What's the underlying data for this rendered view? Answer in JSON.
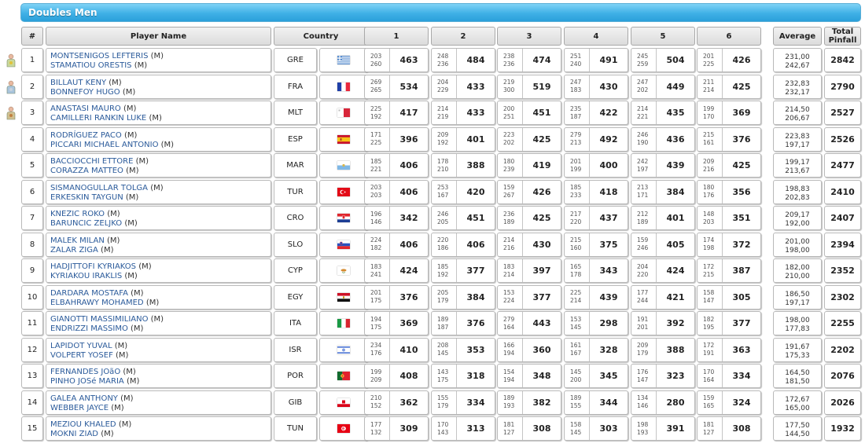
{
  "title": "Doubles Men",
  "headers": {
    "rank": "#",
    "player": "Player Name",
    "country": "Country",
    "games": [
      "1",
      "2",
      "3",
      "4",
      "5",
      "6"
    ],
    "average": "Average",
    "total": "Total Pinfall"
  },
  "colors": {
    "title_bar": "#3fb0e6",
    "player_link": "#2a5a9a"
  },
  "medals": [
    "gold-medal-icon",
    "silver-medal-icon",
    "bronze-medal-icon"
  ],
  "rows": [
    {
      "rank": "1",
      "p1": "MONTSENIGOS LEFTERIS",
      "p2": "STAMATIOU ORESTIS",
      "g1": "(M)",
      "g2": "(M)",
      "country": "GRE",
      "flag": "greece-flag-icon",
      "games": [
        [
          "203",
          "260",
          "463"
        ],
        [
          "248",
          "236",
          "484"
        ],
        [
          "238",
          "236",
          "474"
        ],
        [
          "251",
          "240",
          "491"
        ],
        [
          "245",
          "259",
          "504"
        ],
        [
          "201",
          "225",
          "426"
        ]
      ],
      "avg1": "231,00",
      "avg2": "242,67",
      "total": "2842"
    },
    {
      "rank": "2",
      "p1": "BILLAUT KENY",
      "p2": "BONNEFOY HUGO",
      "g1": "(M)",
      "g2": "(M)",
      "country": "FRA",
      "flag": "france-flag-icon",
      "games": [
        [
          "269",
          "265",
          "534"
        ],
        [
          "204",
          "229",
          "433"
        ],
        [
          "219",
          "300",
          "519"
        ],
        [
          "247",
          "183",
          "430"
        ],
        [
          "247",
          "202",
          "449"
        ],
        [
          "211",
          "214",
          "425"
        ]
      ],
      "avg1": "232,83",
      "avg2": "232,17",
      "total": "2790"
    },
    {
      "rank": "3",
      "p1": "ANASTASI MAURO",
      "p2": "CAMILLERI RANKIN LUKE",
      "g1": "(M)",
      "g2": "(M)",
      "country": "MLT",
      "flag": "malta-flag-icon",
      "games": [
        [
          "225",
          "192",
          "417"
        ],
        [
          "214",
          "219",
          "433"
        ],
        [
          "200",
          "251",
          "451"
        ],
        [
          "235",
          "187",
          "422"
        ],
        [
          "214",
          "221",
          "435"
        ],
        [
          "199",
          "170",
          "369"
        ]
      ],
      "avg1": "214,50",
      "avg2": "206,67",
      "total": "2527"
    },
    {
      "rank": "4",
      "p1": "RODRÍGUEZ PACO",
      "p2": "PICCARI MICHAEL ANTONIO",
      "g1": "(M)",
      "g2": "(M)",
      "country": "ESP",
      "flag": "spain-flag-icon",
      "games": [
        [
          "171",
          "225",
          "396"
        ],
        [
          "209",
          "192",
          "401"
        ],
        [
          "223",
          "202",
          "425"
        ],
        [
          "279",
          "213",
          "492"
        ],
        [
          "246",
          "190",
          "436"
        ],
        [
          "215",
          "161",
          "376"
        ]
      ],
      "avg1": "223,83",
      "avg2": "197,17",
      "total": "2526"
    },
    {
      "rank": "5",
      "p1": "BACCIOCCHI ETTORE",
      "p2": "CORAZZA MATTEO",
      "g1": "(M)",
      "g2": "(M)",
      "country": "MAR",
      "flag": "san-marino-flag-icon",
      "games": [
        [
          "185",
          "221",
          "406"
        ],
        [
          "178",
          "210",
          "388"
        ],
        [
          "180",
          "239",
          "419"
        ],
        [
          "201",
          "199",
          "400"
        ],
        [
          "242",
          "197",
          "439"
        ],
        [
          "209",
          "216",
          "425"
        ]
      ],
      "avg1": "199,17",
      "avg2": "213,67",
      "total": "2477"
    },
    {
      "rank": "6",
      "p1": "SISMANOGULLAR TOLGA",
      "p2": "ERKESKIN TAYGUN",
      "g1": "(M)",
      "g2": "(M)",
      "country": "TUR",
      "flag": "turkey-flag-icon",
      "games": [
        [
          "203",
          "203",
          "406"
        ],
        [
          "253",
          "167",
          "420"
        ],
        [
          "159",
          "267",
          "426"
        ],
        [
          "185",
          "233",
          "418"
        ],
        [
          "213",
          "171",
          "384"
        ],
        [
          "180",
          "176",
          "356"
        ]
      ],
      "avg1": "198,83",
      "avg2": "202,83",
      "total": "2410"
    },
    {
      "rank": "7",
      "p1": "KNEZIC ROKO",
      "p2": "BARUNCIC ZELJKO",
      "g1": "(M)",
      "g2": "(M)",
      "country": "CRO",
      "flag": "croatia-flag-icon",
      "games": [
        [
          "196",
          "146",
          "342"
        ],
        [
          "246",
          "205",
          "451"
        ],
        [
          "236",
          "189",
          "425"
        ],
        [
          "217",
          "220",
          "437"
        ],
        [
          "212",
          "189",
          "401"
        ],
        [
          "148",
          "203",
          "351"
        ]
      ],
      "avg1": "209,17",
      "avg2": "192,00",
      "total": "2407"
    },
    {
      "rank": "8",
      "p1": "MALEK MILAN",
      "p2": "ZALAR ZIGA",
      "g1": "(M)",
      "g2": "(M)",
      "country": "SLO",
      "flag": "slovenia-flag-icon",
      "games": [
        [
          "224",
          "182",
          "406"
        ],
        [
          "220",
          "186",
          "406"
        ],
        [
          "214",
          "216",
          "430"
        ],
        [
          "215",
          "160",
          "375"
        ],
        [
          "159",
          "246",
          "405"
        ],
        [
          "174",
          "198",
          "372"
        ]
      ],
      "avg1": "201,00",
      "avg2": "198,00",
      "total": "2394"
    },
    {
      "rank": "9",
      "p1": "HADJITTOFI KYRIAKOS",
      "p2": "KYRIAKOU IRAKLIS",
      "g1": "(M)",
      "g2": "(M)",
      "country": "CYP",
      "flag": "cyprus-flag-icon",
      "games": [
        [
          "183",
          "241",
          "424"
        ],
        [
          "185",
          "192",
          "377"
        ],
        [
          "183",
          "214",
          "397"
        ],
        [
          "165",
          "178",
          "343"
        ],
        [
          "204",
          "220",
          "424"
        ],
        [
          "172",
          "215",
          "387"
        ]
      ],
      "avg1": "182,00",
      "avg2": "210,00",
      "total": "2352"
    },
    {
      "rank": "10",
      "p1": "DARDARA MOSTAFA",
      "p2": "ELBAHRAWY MOHAMED",
      "g1": "(M)",
      "g2": "(M)",
      "country": "EGY",
      "flag": "egypt-flag-icon",
      "games": [
        [
          "201",
          "175",
          "376"
        ],
        [
          "205",
          "179",
          "384"
        ],
        [
          "153",
          "224",
          "377"
        ],
        [
          "225",
          "214",
          "439"
        ],
        [
          "177",
          "244",
          "421"
        ],
        [
          "158",
          "147",
          "305"
        ]
      ],
      "avg1": "186,50",
      "avg2": "197,17",
      "total": "2302"
    },
    {
      "rank": "11",
      "p1": "GIANOTTI MASSIMILIANO",
      "p2": "ENDRIZZI MASSIMO",
      "g1": "(M)",
      "g2": "(M)",
      "country": "ITA",
      "flag": "italy-flag-icon",
      "games": [
        [
          "194",
          "175",
          "369"
        ],
        [
          "189",
          "187",
          "376"
        ],
        [
          "279",
          "164",
          "443"
        ],
        [
          "153",
          "145",
          "298"
        ],
        [
          "191",
          "201",
          "392"
        ],
        [
          "182",
          "195",
          "377"
        ]
      ],
      "avg1": "198,00",
      "avg2": "177,83",
      "total": "2255"
    },
    {
      "rank": "12",
      "p1": "LAPIDOT YUVAL",
      "p2": "VOLPERT YOSEF",
      "g1": "(M)",
      "g2": "(M)",
      "country": "ISR",
      "flag": "israel-flag-icon",
      "games": [
        [
          "234",
          "176",
          "410"
        ],
        [
          "208",
          "145",
          "353"
        ],
        [
          "166",
          "194",
          "360"
        ],
        [
          "161",
          "167",
          "328"
        ],
        [
          "209",
          "179",
          "388"
        ],
        [
          "172",
          "191",
          "363"
        ]
      ],
      "avg1": "191,67",
      "avg2": "175,33",
      "total": "2202"
    },
    {
      "rank": "13",
      "p1": "FERNANDES JOãO",
      "p2": "PINHO JOSé MARIA",
      "g1": "(M)",
      "g2": "(M)",
      "country": "POR",
      "flag": "portugal-flag-icon",
      "games": [
        [
          "199",
          "209",
          "408"
        ],
        [
          "143",
          "175",
          "318"
        ],
        [
          "154",
          "194",
          "348"
        ],
        [
          "145",
          "200",
          "345"
        ],
        [
          "176",
          "147",
          "323"
        ],
        [
          "170",
          "164",
          "334"
        ]
      ],
      "avg1": "164,50",
      "avg2": "181,50",
      "total": "2076"
    },
    {
      "rank": "14",
      "p1": "GALEA ANTHONY",
      "p2": "WEBBER JAYCE",
      "g1": "(M)",
      "g2": "(M)",
      "country": "GIB",
      "flag": "gibraltar-flag-icon",
      "games": [
        [
          "210",
          "152",
          "362"
        ],
        [
          "155",
          "179",
          "334"
        ],
        [
          "189",
          "193",
          "382"
        ],
        [
          "189",
          "155",
          "344"
        ],
        [
          "134",
          "146",
          "280"
        ],
        [
          "159",
          "165",
          "324"
        ]
      ],
      "avg1": "172,67",
      "avg2": "165,00",
      "total": "2026"
    },
    {
      "rank": "15",
      "p1": "MEZIOU KHALED",
      "p2": "MOKNI ZIAD",
      "g1": "(M)",
      "g2": "(M)",
      "country": "TUN",
      "flag": "tunisia-flag-icon",
      "games": [
        [
          "177",
          "132",
          "309"
        ],
        [
          "170",
          "143",
          "313"
        ],
        [
          "181",
          "127",
          "308"
        ],
        [
          "158",
          "145",
          "303"
        ],
        [
          "198",
          "193",
          "391"
        ],
        [
          "181",
          "127",
          "308"
        ]
      ],
      "avg1": "177,50",
      "avg2": "144,50",
      "total": "1932"
    }
  ]
}
